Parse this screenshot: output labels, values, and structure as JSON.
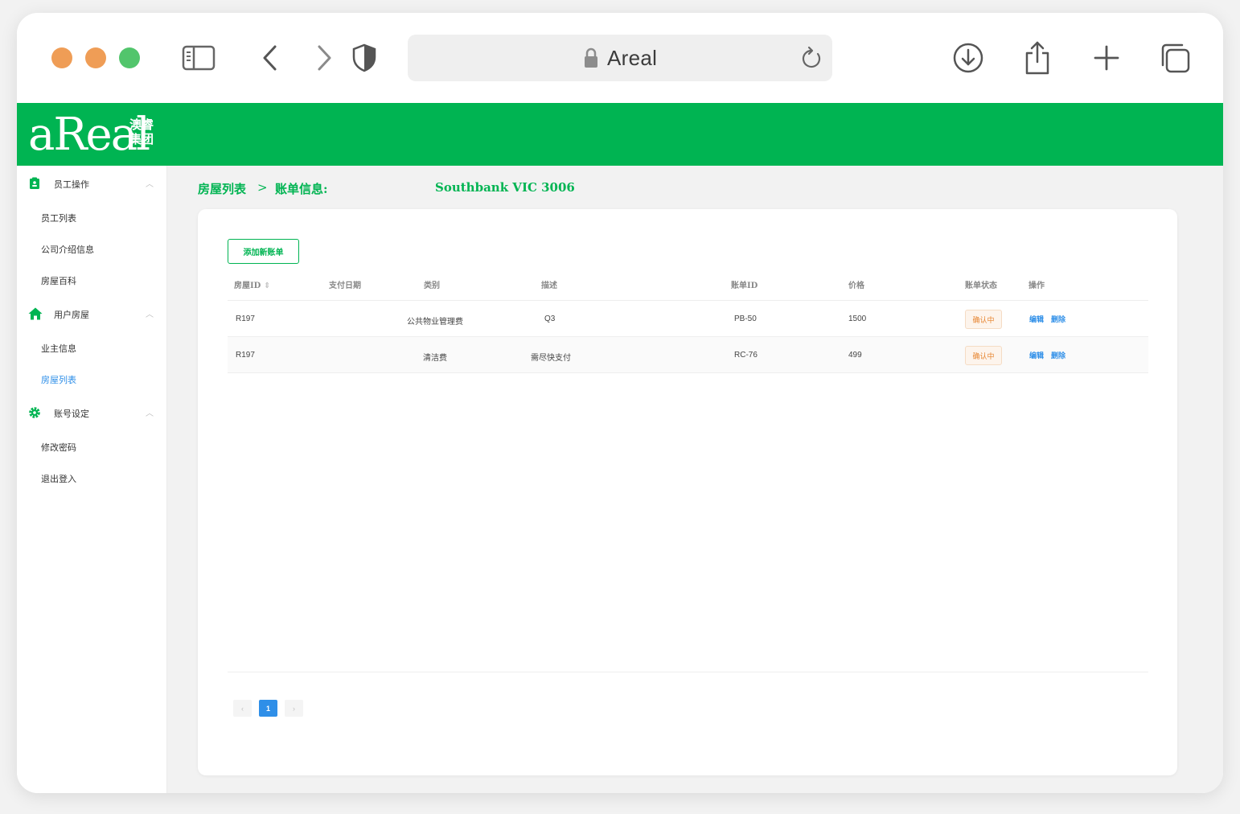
{
  "browser": {
    "url_text": "Areal"
  },
  "header": {
    "logo_text": "aReal",
    "logo_cn_line1": "澳睿",
    "logo_cn_line2": "集团"
  },
  "sidebar": {
    "groups": [
      {
        "label": "员工操作",
        "items": [
          "员工列表",
          "公司介绍信息",
          "房屋百科"
        ]
      },
      {
        "label": "用户房屋",
        "items": [
          "业主信息",
          "房屋列表"
        ]
      },
      {
        "label": "账号设定",
        "items": [
          "修改密码",
          "退出登入"
        ]
      }
    ],
    "active_item": "房屋列表"
  },
  "breadcrumb": {
    "parent": "房屋列表",
    "separator": ">",
    "current": "账单信息:",
    "address": "Southbank VIC 3006"
  },
  "toolbar": {
    "add_label": "添加新账单"
  },
  "table": {
    "columns": [
      "房屋ID",
      "支付日期",
      "类别",
      "描述",
      "账单ID",
      "价格",
      "账单状态",
      "操作"
    ],
    "sort_icon": "⇕",
    "rows": [
      {
        "house_id": "R197",
        "pay_date": "",
        "category": "公共物业管理费",
        "description": "Q3",
        "bill_id": "PB-50",
        "price": "1500",
        "status": "确认中",
        "edit": "编辑",
        "delete": "删除"
      },
      {
        "house_id": "R197",
        "pay_date": "",
        "category": "清洁费",
        "description": "需尽快支付",
        "bill_id": "RC-76",
        "price": "499",
        "status": "确认中",
        "edit": "编辑",
        "delete": "删除"
      }
    ]
  },
  "pagination": {
    "prev": "‹",
    "current": "1",
    "next": "›"
  },
  "colors": {
    "brand_green": "#00b452",
    "link_blue": "#2f8fe8",
    "status_orange": "#e6832e"
  }
}
